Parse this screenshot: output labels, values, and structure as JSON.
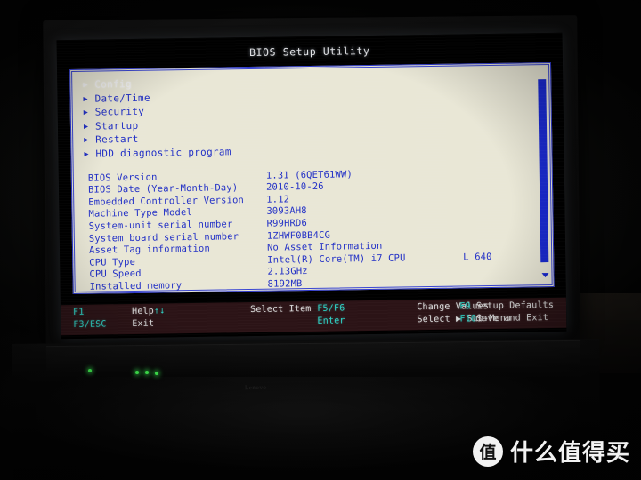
{
  "screen": {
    "title": "BIOS Setup Utility"
  },
  "menu": {
    "arrow_glyph": "▶",
    "items": [
      {
        "label": "Config",
        "selected": true
      },
      {
        "label": "Date/Time",
        "selected": false
      },
      {
        "label": "Security",
        "selected": false
      },
      {
        "label": "Startup",
        "selected": false
      },
      {
        "label": "Restart",
        "selected": false
      },
      {
        "label": "HDD diagnostic program",
        "selected": false
      }
    ]
  },
  "info": {
    "rows": [
      {
        "label": "BIOS Version",
        "value": "1.31   (6QET61WW)",
        "extra": ""
      },
      {
        "label": "BIOS Date (Year-Month-Day)",
        "value": "2010-10-26",
        "extra": ""
      },
      {
        "label": "Embedded Controller Version",
        "value": "1.12",
        "extra": ""
      },
      {
        "label": "Machine Type Model",
        "value": "3093AH8",
        "extra": ""
      },
      {
        "label": "System-unit serial number",
        "value": "R99HRD6",
        "extra": ""
      },
      {
        "label": "System board serial number",
        "value": "1ZHWF0BB4CG",
        "extra": ""
      },
      {
        "label": "Asset Tag information",
        "value": "No Asset Information",
        "extra": ""
      },
      {
        "label": "CPU Type",
        "value": "Intel(R) Core(TM) i7 CPU",
        "extra": "L 640"
      },
      {
        "label": "CPU Speed",
        "value": "2.13GHz",
        "extra": ""
      },
      {
        "label": "Installed memory",
        "value": "8192MB",
        "extra": ""
      }
    ]
  },
  "scrollbar": {
    "down_arrow_glyph": "▼"
  },
  "helpbar": {
    "columns": [
      {
        "lines": [
          {
            "key": "F1",
            "desc": ""
          },
          {
            "key": "F3/ESC",
            "desc": ""
          }
        ]
      },
      {
        "lines": [
          {
            "key": "",
            "desc": "Help",
            "glyph": "↑↓"
          },
          {
            "key": "",
            "desc": "Exit",
            "glyph": ""
          }
        ]
      },
      {
        "lines": [
          {
            "key": "",
            "desc": "Select Item"
          },
          {
            "key": "",
            "desc": ""
          }
        ]
      },
      {
        "lines": [
          {
            "key": "F5/F6",
            "desc": ""
          },
          {
            "key": "Enter",
            "desc": ""
          }
        ]
      },
      {
        "lines": [
          {
            "key": "",
            "desc": "Change Values"
          },
          {
            "key": "",
            "desc": "Select ▶ Sub-Menu"
          }
        ]
      },
      {
        "lines": [
          {
            "key": "F9",
            "desc": ""
          },
          {
            "key": "F10",
            "desc": ""
          }
        ]
      },
      {
        "lines": [
          {
            "key": "",
            "desc": "Setup Defaults"
          },
          {
            "key": "",
            "desc": "Save and Exit"
          }
        ]
      }
    ]
  },
  "laptop": {
    "bezel_logo": "Lenovo"
  },
  "watermark": {
    "badge": "值",
    "text": "什么值得买"
  },
  "colors": {
    "panel_bg": "#e9e7d6",
    "bios_blue": "#2230c6",
    "scrollbar_blue": "#1a2ad0",
    "helpbar_bg": "#2b1316",
    "help_key_teal": "#2fd3c6",
    "help_desc": "#dcdcdc",
    "led_green": "#46ff55"
  }
}
